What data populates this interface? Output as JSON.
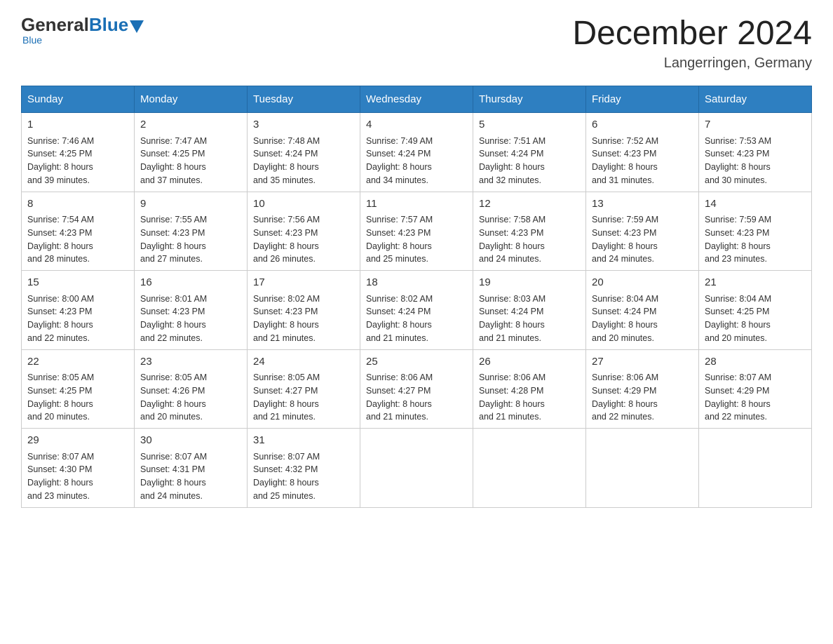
{
  "header": {
    "logo_general": "General",
    "logo_blue": "Blue",
    "month_title": "December 2024",
    "location": "Langerringen, Germany"
  },
  "days_of_week": [
    "Sunday",
    "Monday",
    "Tuesday",
    "Wednesday",
    "Thursday",
    "Friday",
    "Saturday"
  ],
  "weeks": [
    [
      {
        "day": 1,
        "sunrise": "7:46 AM",
        "sunset": "4:25 PM",
        "daylight": "8 hours and 39 minutes."
      },
      {
        "day": 2,
        "sunrise": "7:47 AM",
        "sunset": "4:25 PM",
        "daylight": "8 hours and 37 minutes."
      },
      {
        "day": 3,
        "sunrise": "7:48 AM",
        "sunset": "4:24 PM",
        "daylight": "8 hours and 35 minutes."
      },
      {
        "day": 4,
        "sunrise": "7:49 AM",
        "sunset": "4:24 PM",
        "daylight": "8 hours and 34 minutes."
      },
      {
        "day": 5,
        "sunrise": "7:51 AM",
        "sunset": "4:24 PM",
        "daylight": "8 hours and 32 minutes."
      },
      {
        "day": 6,
        "sunrise": "7:52 AM",
        "sunset": "4:23 PM",
        "daylight": "8 hours and 31 minutes."
      },
      {
        "day": 7,
        "sunrise": "7:53 AM",
        "sunset": "4:23 PM",
        "daylight": "8 hours and 30 minutes."
      }
    ],
    [
      {
        "day": 8,
        "sunrise": "7:54 AM",
        "sunset": "4:23 PM",
        "daylight": "8 hours and 28 minutes."
      },
      {
        "day": 9,
        "sunrise": "7:55 AM",
        "sunset": "4:23 PM",
        "daylight": "8 hours and 27 minutes."
      },
      {
        "day": 10,
        "sunrise": "7:56 AM",
        "sunset": "4:23 PM",
        "daylight": "8 hours and 26 minutes."
      },
      {
        "day": 11,
        "sunrise": "7:57 AM",
        "sunset": "4:23 PM",
        "daylight": "8 hours and 25 minutes."
      },
      {
        "day": 12,
        "sunrise": "7:58 AM",
        "sunset": "4:23 PM",
        "daylight": "8 hours and 24 minutes."
      },
      {
        "day": 13,
        "sunrise": "7:59 AM",
        "sunset": "4:23 PM",
        "daylight": "8 hours and 24 minutes."
      },
      {
        "day": 14,
        "sunrise": "7:59 AM",
        "sunset": "4:23 PM",
        "daylight": "8 hours and 23 minutes."
      }
    ],
    [
      {
        "day": 15,
        "sunrise": "8:00 AM",
        "sunset": "4:23 PM",
        "daylight": "8 hours and 22 minutes."
      },
      {
        "day": 16,
        "sunrise": "8:01 AM",
        "sunset": "4:23 PM",
        "daylight": "8 hours and 22 minutes."
      },
      {
        "day": 17,
        "sunrise": "8:02 AM",
        "sunset": "4:23 PM",
        "daylight": "8 hours and 21 minutes."
      },
      {
        "day": 18,
        "sunrise": "8:02 AM",
        "sunset": "4:24 PM",
        "daylight": "8 hours and 21 minutes."
      },
      {
        "day": 19,
        "sunrise": "8:03 AM",
        "sunset": "4:24 PM",
        "daylight": "8 hours and 21 minutes."
      },
      {
        "day": 20,
        "sunrise": "8:04 AM",
        "sunset": "4:24 PM",
        "daylight": "8 hours and 20 minutes."
      },
      {
        "day": 21,
        "sunrise": "8:04 AM",
        "sunset": "4:25 PM",
        "daylight": "8 hours and 20 minutes."
      }
    ],
    [
      {
        "day": 22,
        "sunrise": "8:05 AM",
        "sunset": "4:25 PM",
        "daylight": "8 hours and 20 minutes."
      },
      {
        "day": 23,
        "sunrise": "8:05 AM",
        "sunset": "4:26 PM",
        "daylight": "8 hours and 20 minutes."
      },
      {
        "day": 24,
        "sunrise": "8:05 AM",
        "sunset": "4:27 PM",
        "daylight": "8 hours and 21 minutes."
      },
      {
        "day": 25,
        "sunrise": "8:06 AM",
        "sunset": "4:27 PM",
        "daylight": "8 hours and 21 minutes."
      },
      {
        "day": 26,
        "sunrise": "8:06 AM",
        "sunset": "4:28 PM",
        "daylight": "8 hours and 21 minutes."
      },
      {
        "day": 27,
        "sunrise": "8:06 AM",
        "sunset": "4:29 PM",
        "daylight": "8 hours and 22 minutes."
      },
      {
        "day": 28,
        "sunrise": "8:07 AM",
        "sunset": "4:29 PM",
        "daylight": "8 hours and 22 minutes."
      }
    ],
    [
      {
        "day": 29,
        "sunrise": "8:07 AM",
        "sunset": "4:30 PM",
        "daylight": "8 hours and 23 minutes."
      },
      {
        "day": 30,
        "sunrise": "8:07 AM",
        "sunset": "4:31 PM",
        "daylight": "8 hours and 24 minutes."
      },
      {
        "day": 31,
        "sunrise": "8:07 AM",
        "sunset": "4:32 PM",
        "daylight": "8 hours and 25 minutes."
      },
      null,
      null,
      null,
      null
    ]
  ],
  "labels": {
    "sunrise": "Sunrise:",
    "sunset": "Sunset:",
    "daylight": "Daylight:"
  }
}
